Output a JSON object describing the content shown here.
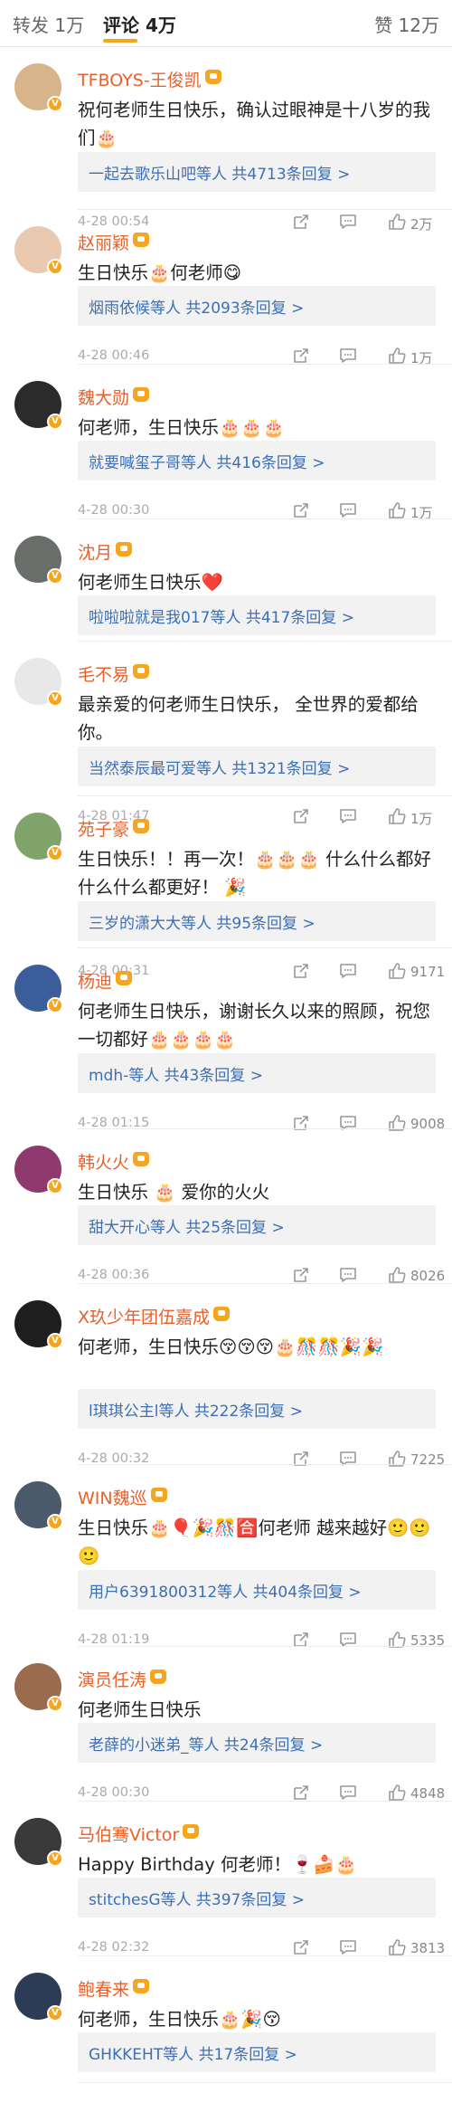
{
  "tabs": {
    "reposts": "转发 1万",
    "comments": "评论 4万",
    "likes": "赞 12万"
  },
  "colors": {
    "accent": "#f7a51c",
    "name": "#e8612a",
    "link": "#3b6fb6"
  },
  "comments": [
    {
      "name": "TFBOYS-王俊凯",
      "text": "祝何老师生日快乐，确认过眼神是十八岁的我们🎂",
      "reply": "一起去歌乐山吧等人  共4713条回复 >",
      "time": "4-28 00:54",
      "likes": "2万",
      "avatar_color": "#d8b48a"
    },
    {
      "name": "赵丽颖",
      "text": "生日快乐🎂何老师😋",
      "reply": "烟雨依候等人  共2093条回复 >",
      "time": "4-28 00:46",
      "likes": "1万",
      "avatar_color": "#e9c9b0"
    },
    {
      "name": "魏大勋",
      "text": "何老师，生日快乐🎂🎂🎂",
      "reply": "就要喊玺子哥等人  共416条回复 >",
      "time": "4-28 00:30",
      "likes": "1万",
      "avatar_color": "#2b2b2b"
    },
    {
      "name": "沈月",
      "text": "何老师生日快乐❤️",
      "reply": "啦啦啦就是我017等人  共417条回复 >",
      "time": "",
      "likes": "",
      "avatar_color": "#6a6e6a"
    },
    {
      "name": "毛不易",
      "text": "最亲爱的何老师生日快乐， 全世界的爱都给你。",
      "reply": "当然泰辰最可爱等人  共1321条回复 >",
      "time": "4-28 01:47",
      "likes": "1万",
      "avatar_color": "#e8e8e8"
    },
    {
      "name": "苑子豪",
      "text": "生日快乐！！再一次！🎂🎂🎂 什么什么都好 什么什么都更好！ 🎉",
      "reply": "三岁的潇大大等人  共95条回复 >",
      "time": "4-28 00:31",
      "likes": "9171",
      "avatar_color": "#7fa36b"
    },
    {
      "name": "杨迪",
      "text": "何老师生日快乐，谢谢长久以来的照顾，祝您一切都好🎂🎂🎂🎂",
      "reply": "mdh-等人  共43条回复 >",
      "time": "4-28 01:15",
      "likes": "9008",
      "avatar_color": "#3b5e9a"
    },
    {
      "name": "韩火火",
      "text": "生日快乐 🎂 爱你的火火",
      "reply": "甜大开心等人  共25条回复 >",
      "time": "4-28 00:36",
      "likes": "8026",
      "avatar_color": "#8e3a6e"
    },
    {
      "name": "X玖少年团伍嘉成",
      "text": "何老师，生日快乐😚😚😚🎂🎊🎊🎉🎉",
      "reply": "l琪琪公主l等人  共222条回复 >",
      "time": "4-28 00:32",
      "likes": "7225",
      "avatar_color": "#1e1e1e"
    },
    {
      "name": "WIN魏巡",
      "text": "生日快乐🎂🎈🎉🎊🈴何老师 越来越好🙂🙂🙂",
      "reply": "用户6391800312等人  共404条回复 >",
      "time": "4-28 01:19",
      "likes": "5335",
      "avatar_color": "#4a5a6a"
    },
    {
      "name": "演员任涛",
      "text": "何老师生日快乐",
      "reply": "老薛的小迷弟_等人  共24条回复 >",
      "time": "4-28 00:30",
      "likes": "4848",
      "avatar_color": "#9a6b4f"
    },
    {
      "name": "马伯骞Victor",
      "text": "Happy Birthday 何老师！🍷🍰🎂",
      "reply": "stitchesG等人  共397条回复 >",
      "time": "4-28 02:32",
      "likes": "3813",
      "avatar_color": "#3a3a3a"
    },
    {
      "name": "鲍春来",
      "text": "何老师，生日快乐🎂🎉😚",
      "reply": "GHKKEHT等人  共17条回复 >",
      "time": "",
      "likes": "",
      "avatar_color": "#2c3c55"
    }
  ]
}
